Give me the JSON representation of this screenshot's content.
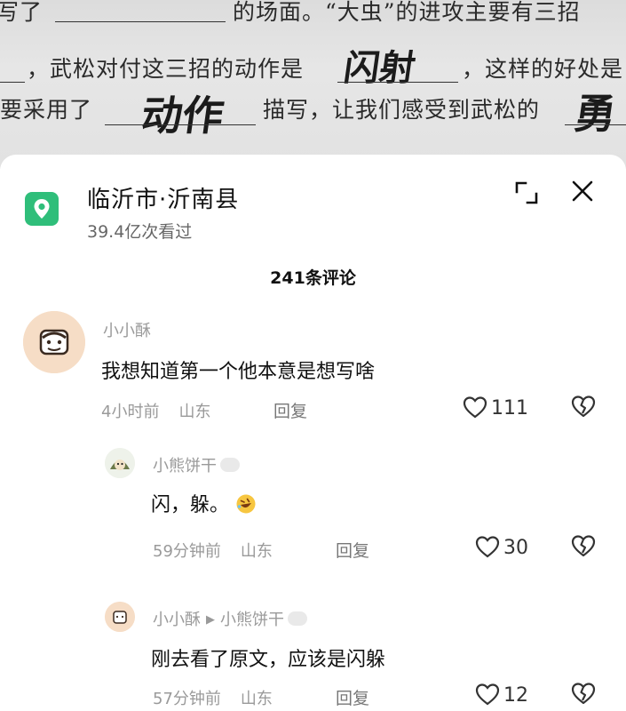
{
  "worksheet": {
    "line1_left": "写了",
    "line1_right": "的场面。“大虫”的进攻主要有三招",
    "line2_left": "，武松对付这三招的动作是",
    "line2_answer": "闪射",
    "line2_right": "，这样的好处是",
    "line3_left": "要采用了",
    "line3_answer": "动作",
    "line3_right": "描写，让我们感受到武松的",
    "line3_tail": "勇"
  },
  "location": {
    "title": "临沂市·沂南县",
    "views": "39.4亿次看过"
  },
  "comments_header": {
    "count_label": "241条评论"
  },
  "comments": [
    {
      "user": "小小酥",
      "text": "我想知道第一个他本意是想写啥",
      "time": "4小时前",
      "region": "山东",
      "reply": "回复",
      "likes": "111"
    },
    {
      "user": "小熊饼干",
      "text": "闪，躲。",
      "emoji": "🤣",
      "time": "59分钟前",
      "region": "山东",
      "reply": "回复",
      "likes": "30"
    },
    {
      "user": "小小酥",
      "reply_to": "小熊饼干",
      "text": "刚去看了原文，应该是闪躲",
      "time": "57分钟前",
      "region": "山东",
      "reply": "回复",
      "likes": "12"
    }
  ],
  "colors": {
    "location_icon": "#2fbe7a",
    "muted_text": "#9a9a9a"
  },
  "icons": [
    "location-pin-icon",
    "expand-icon",
    "close-icon",
    "heart-icon",
    "broken-heart-icon"
  ]
}
